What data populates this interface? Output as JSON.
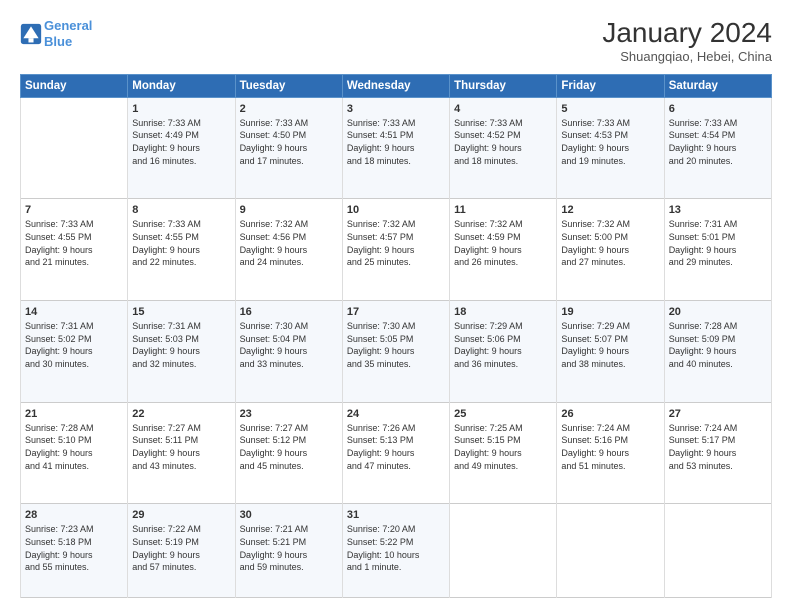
{
  "header": {
    "logo_line1": "General",
    "logo_line2": "Blue",
    "title": "January 2024",
    "subtitle": "Shuangqiao, Hebei, China"
  },
  "weekdays": [
    "Sunday",
    "Monday",
    "Tuesday",
    "Wednesday",
    "Thursday",
    "Friday",
    "Saturday"
  ],
  "weeks": [
    [
      {
        "day": "",
        "info": ""
      },
      {
        "day": "1",
        "info": "Sunrise: 7:33 AM\nSunset: 4:49 PM\nDaylight: 9 hours\nand 16 minutes."
      },
      {
        "day": "2",
        "info": "Sunrise: 7:33 AM\nSunset: 4:50 PM\nDaylight: 9 hours\nand 17 minutes."
      },
      {
        "day": "3",
        "info": "Sunrise: 7:33 AM\nSunset: 4:51 PM\nDaylight: 9 hours\nand 18 minutes."
      },
      {
        "day": "4",
        "info": "Sunrise: 7:33 AM\nSunset: 4:52 PM\nDaylight: 9 hours\nand 18 minutes."
      },
      {
        "day": "5",
        "info": "Sunrise: 7:33 AM\nSunset: 4:53 PM\nDaylight: 9 hours\nand 19 minutes."
      },
      {
        "day": "6",
        "info": "Sunrise: 7:33 AM\nSunset: 4:54 PM\nDaylight: 9 hours\nand 20 minutes."
      }
    ],
    [
      {
        "day": "7",
        "info": "Sunrise: 7:33 AM\nSunset: 4:55 PM\nDaylight: 9 hours\nand 21 minutes."
      },
      {
        "day": "8",
        "info": "Sunrise: 7:33 AM\nSunset: 4:55 PM\nDaylight: 9 hours\nand 22 minutes."
      },
      {
        "day": "9",
        "info": "Sunrise: 7:32 AM\nSunset: 4:56 PM\nDaylight: 9 hours\nand 24 minutes."
      },
      {
        "day": "10",
        "info": "Sunrise: 7:32 AM\nSunset: 4:57 PM\nDaylight: 9 hours\nand 25 minutes."
      },
      {
        "day": "11",
        "info": "Sunrise: 7:32 AM\nSunset: 4:59 PM\nDaylight: 9 hours\nand 26 minutes."
      },
      {
        "day": "12",
        "info": "Sunrise: 7:32 AM\nSunset: 5:00 PM\nDaylight: 9 hours\nand 27 minutes."
      },
      {
        "day": "13",
        "info": "Sunrise: 7:31 AM\nSunset: 5:01 PM\nDaylight: 9 hours\nand 29 minutes."
      }
    ],
    [
      {
        "day": "14",
        "info": "Sunrise: 7:31 AM\nSunset: 5:02 PM\nDaylight: 9 hours\nand 30 minutes."
      },
      {
        "day": "15",
        "info": "Sunrise: 7:31 AM\nSunset: 5:03 PM\nDaylight: 9 hours\nand 32 minutes."
      },
      {
        "day": "16",
        "info": "Sunrise: 7:30 AM\nSunset: 5:04 PM\nDaylight: 9 hours\nand 33 minutes."
      },
      {
        "day": "17",
        "info": "Sunrise: 7:30 AM\nSunset: 5:05 PM\nDaylight: 9 hours\nand 35 minutes."
      },
      {
        "day": "18",
        "info": "Sunrise: 7:29 AM\nSunset: 5:06 PM\nDaylight: 9 hours\nand 36 minutes."
      },
      {
        "day": "19",
        "info": "Sunrise: 7:29 AM\nSunset: 5:07 PM\nDaylight: 9 hours\nand 38 minutes."
      },
      {
        "day": "20",
        "info": "Sunrise: 7:28 AM\nSunset: 5:09 PM\nDaylight: 9 hours\nand 40 minutes."
      }
    ],
    [
      {
        "day": "21",
        "info": "Sunrise: 7:28 AM\nSunset: 5:10 PM\nDaylight: 9 hours\nand 41 minutes."
      },
      {
        "day": "22",
        "info": "Sunrise: 7:27 AM\nSunset: 5:11 PM\nDaylight: 9 hours\nand 43 minutes."
      },
      {
        "day": "23",
        "info": "Sunrise: 7:27 AM\nSunset: 5:12 PM\nDaylight: 9 hours\nand 45 minutes."
      },
      {
        "day": "24",
        "info": "Sunrise: 7:26 AM\nSunset: 5:13 PM\nDaylight: 9 hours\nand 47 minutes."
      },
      {
        "day": "25",
        "info": "Sunrise: 7:25 AM\nSunset: 5:15 PM\nDaylight: 9 hours\nand 49 minutes."
      },
      {
        "day": "26",
        "info": "Sunrise: 7:24 AM\nSunset: 5:16 PM\nDaylight: 9 hours\nand 51 minutes."
      },
      {
        "day": "27",
        "info": "Sunrise: 7:24 AM\nSunset: 5:17 PM\nDaylight: 9 hours\nand 53 minutes."
      }
    ],
    [
      {
        "day": "28",
        "info": "Sunrise: 7:23 AM\nSunset: 5:18 PM\nDaylight: 9 hours\nand 55 minutes."
      },
      {
        "day": "29",
        "info": "Sunrise: 7:22 AM\nSunset: 5:19 PM\nDaylight: 9 hours\nand 57 minutes."
      },
      {
        "day": "30",
        "info": "Sunrise: 7:21 AM\nSunset: 5:21 PM\nDaylight: 9 hours\nand 59 minutes."
      },
      {
        "day": "31",
        "info": "Sunrise: 7:20 AM\nSunset: 5:22 PM\nDaylight: 10 hours\nand 1 minute."
      },
      {
        "day": "",
        "info": ""
      },
      {
        "day": "",
        "info": ""
      },
      {
        "day": "",
        "info": ""
      }
    ]
  ]
}
